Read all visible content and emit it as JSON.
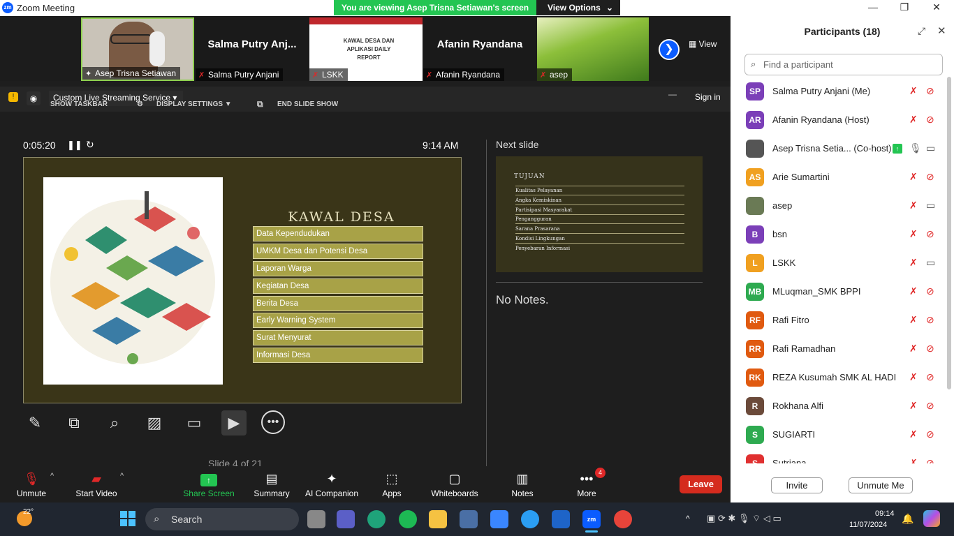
{
  "window": {
    "title": "Zoom Meeting",
    "logo": "zm",
    "minimize": "—",
    "maximize": "❐",
    "close": "✕"
  },
  "share_banner": {
    "text": "You are viewing Asep Trisna Setiawan's screen",
    "view_options": "View Options"
  },
  "thumbnails": [
    {
      "name": "Asep Trisna Setiawan",
      "big": ""
    },
    {
      "name": "Salma Putry Anjani",
      "big": "Salma Putry Anj..."
    },
    {
      "name": "LSKK",
      "big": ""
    },
    {
      "name": "Afanin Ryandana",
      "big": "Afanin Ryandana"
    },
    {
      "name": "asep",
      "big": ""
    }
  ],
  "thumb_slide_text": "KAWAL DESA DAN APLIKASI DAILY REPORT",
  "view_label": "View",
  "presenter": {
    "streaming": "Custom Live Streaming Service",
    "sign_in": "Sign in",
    "show_taskbar": "SHOW TASKBAR",
    "display_settings": "DISPLAY SETTINGS ▼",
    "end_slide_show": "END SLIDE SHOW",
    "timer": "0:05:20",
    "clock": "9:14 AM",
    "next_slide_label": "Next slide",
    "notes": "No Notes.",
    "slide_nav": "Slide 4 of 21"
  },
  "slide": {
    "title": "KAWAL DESA",
    "items": [
      "Data Kependudukan",
      "UMKM Desa dan Potensi Desa",
      "Laporan Warga",
      "Kegiatan Desa",
      "Berita Desa",
      "Early Warning System",
      "Surat Menyurat",
      "Informasi Desa"
    ]
  },
  "next_slide": {
    "title": "TUJUAN",
    "items": [
      "Kualitas Pelayanan",
      "Angka Kemiskinan",
      "Partisipasi Masyarakat",
      "Pengangguran",
      "Sarana Prasarana",
      "Kondisi Lingkungan",
      "Penyebaran Informasi"
    ]
  },
  "toolbar": {
    "unmute": "Unmute",
    "start_video": "Start Video",
    "share_screen": "Share Screen",
    "summary": "Summary",
    "ai_companion": "AI Companion",
    "apps": "Apps",
    "whiteboards": "Whiteboards",
    "notes": "Notes",
    "more": "More",
    "more_badge": "4",
    "leave": "Leave"
  },
  "participants": {
    "title": "Participants (18)",
    "search_placeholder": "Find a participant",
    "list": [
      {
        "initials": "SP",
        "name": "Salma Putry Anjani (Me)",
        "color": "#7b3fb8"
      },
      {
        "initials": "AR",
        "name": "Afanin Ryandana (Host)",
        "color": "#7b3fb8"
      },
      {
        "initials": "",
        "name": "Asep Trisna Setia... (Co-host)",
        "color": "#555555"
      },
      {
        "initials": "AS",
        "name": "Arie Sumartini",
        "color": "#f0a020"
      },
      {
        "initials": "",
        "name": "asep",
        "color": "#6a7a55"
      },
      {
        "initials": "B",
        "name": "bsn",
        "color": "#7b3fb8"
      },
      {
        "initials": "L",
        "name": "LSKK",
        "color": "#f0a020"
      },
      {
        "initials": "MB",
        "name": "MLuqman_SMK BPPI",
        "color": "#2eaa50"
      },
      {
        "initials": "RF",
        "name": "Rafi Fitro",
        "color": "#e05a10"
      },
      {
        "initials": "RR",
        "name": "Rafi Ramadhan",
        "color": "#e05a10"
      },
      {
        "initials": "RK",
        "name": "REZA Kusumah SMK AL HADI",
        "color": "#e05a10"
      },
      {
        "initials": "R",
        "name": "Rokhana Alfi",
        "color": "#6b4a3a"
      },
      {
        "initials": "S",
        "name": "SUGIARTI",
        "color": "#2eaa50"
      },
      {
        "initials": "S",
        "name": "Sutriana",
        "color": "#e03030"
      }
    ],
    "invite": "Invite",
    "unmute_me": "Unmute Me"
  },
  "taskbar": {
    "temperature": "22°",
    "search": "Search",
    "time": "09:14",
    "date": "11/07/2024"
  }
}
